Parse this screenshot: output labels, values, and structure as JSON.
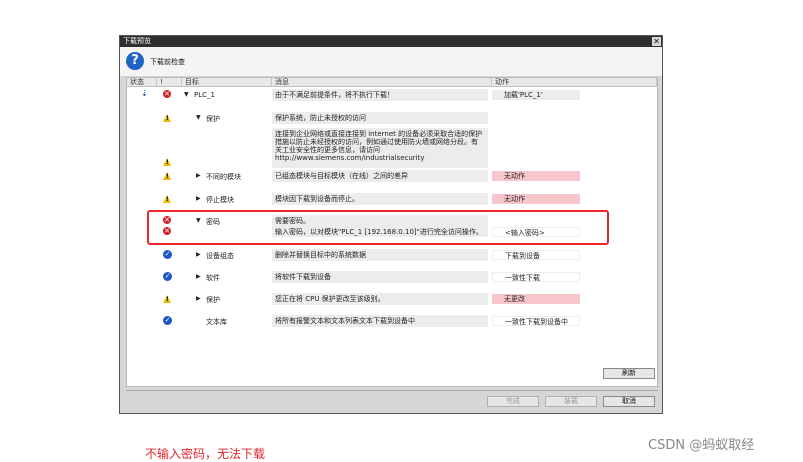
{
  "dialog": {
    "title": "下载预览",
    "header": "下载前检查"
  },
  "columns": [
    "状态",
    "!",
    "目标",
    "消息",
    "动作"
  ],
  "rows": [
    {
      "icon": "error",
      "status_icon": "download",
      "expand": "down",
      "indent": 0,
      "target": "PLC_1",
      "message": "由于不满足前提条件，将不执行下载！",
      "action": "加载'PLC_1'",
      "action_style": "gray"
    },
    {
      "icon": "warn",
      "expand": "down",
      "indent": 1,
      "target": "保护",
      "message": "保护系统，防止未授权的访问",
      "action": "",
      "action_style": "none"
    },
    {
      "icon": "warn",
      "expand": "",
      "indent": 1,
      "target": "",
      "message_lines": [
        "连接到企业网络或直接连接到 internet 的设备必须采取合适的保护",
        "措施以防止未经授权的访问，例如通过使用防火墙或网络分段。有",
        "关工业安全性的更多信息，请访问",
        "http://www.siemens.com/industrialsecurity"
      ],
      "action": "",
      "action_style": "none"
    },
    {
      "icon": "warn",
      "expand": "right",
      "indent": 1,
      "target": "不同的模块",
      "message": "已组态模块与目标模块（在线）之间的差异",
      "action": "无动作",
      "action_style": "pink"
    },
    {
      "icon": "warn",
      "expand": "right",
      "indent": 1,
      "target": "停止模块",
      "message": "模块因下载到设备而停止。",
      "action": "无动作",
      "action_style": "pink"
    },
    {
      "icon": "error",
      "expand": "down",
      "indent": 1,
      "target": "密码",
      "message": "需要密码。",
      "action": "",
      "action_style": "none"
    },
    {
      "icon": "error",
      "expand": "",
      "indent": 1,
      "target": "",
      "message": "输入密码，以对模块\"PLC_1 [192.168.0.10]\"进行完全访问操作。",
      "action": "<输入密码>",
      "action_style": "white"
    },
    {
      "icon": "ok",
      "expand": "right",
      "indent": 1,
      "target": "设备组态",
      "message": "删除并替换目标中的系统数据",
      "action": "下载到设备",
      "action_style": "white"
    },
    {
      "icon": "ok",
      "expand": "right",
      "indent": 1,
      "target": "软件",
      "message": "将软件下载到设备",
      "action": "一致性下载",
      "action_style": "white"
    },
    {
      "icon": "warn",
      "expand": "right",
      "indent": 1,
      "target": "保护",
      "message": "您正在将 CPU 保护更改至该级别。",
      "action": "无更改",
      "action_style": "pink"
    },
    {
      "icon": "ok",
      "expand": "",
      "indent": 1,
      "target": "文本库",
      "message": "将所有报警文本和文本列表文本下载到设备中",
      "action": "一致性下载到设备中",
      "action_style": "white"
    }
  ],
  "buttons": {
    "refresh": "刷新",
    "finish": "完成",
    "load": "装载",
    "cancel": "取消"
  },
  "caption": "不输入密码，无法下载",
  "watermark": "CSDN @蚂蚁取经",
  "colors": {
    "highlight": "#e8262b",
    "pink": "#f6c6cc",
    "error": "#d3202a",
    "ok": "#1e56c8",
    "warn": "#e8b800"
  }
}
